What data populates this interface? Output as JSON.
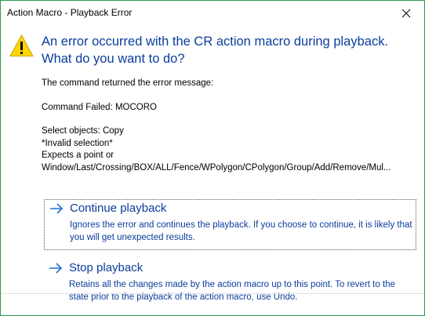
{
  "window": {
    "title": "Action Macro - Playback Error",
    "close_glyph": "✕"
  },
  "dialog": {
    "icon": "warning-icon",
    "main_instruction": "An error occurred with the CR action macro during playback. What do you want to do?",
    "content_lines_a": [
      "The command returned the error message:"
    ],
    "content_lines_b": [
      "Command Failed: MOCORO"
    ],
    "content_lines_c": [
      "Select objects: Copy",
      "*Invalid selection*",
      "Expects a point or",
      "Window/Last/Crossing/BOX/ALL/Fence/WPolygon/CPolygon/Group/Add/Remove/Mul..."
    ]
  },
  "commands": [
    {
      "title": "Continue playback",
      "description": "Ignores the error and continues the playback. If you choose to continue, it is likely that you will get unexpected results."
    },
    {
      "title": "Stop playback",
      "description": "Retains all the changes made by the action macro up to this point. To revert to the state prior to the playback of the action macro, use Undo."
    }
  ],
  "colors": {
    "accent": "#0a3d9c",
    "arrow": "#1f6fd1",
    "window_border": "#2b9a48",
    "warning_fill": "#ffd400"
  }
}
